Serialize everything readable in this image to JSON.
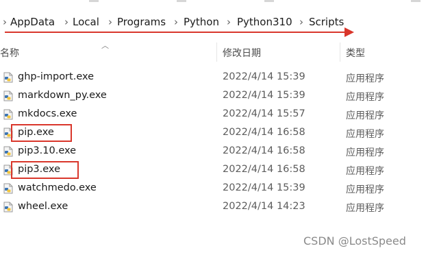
{
  "breadcrumb": {
    "items": [
      "AppData",
      "Local",
      "Programs",
      "Python",
      "Python310",
      "Scripts"
    ],
    "separator": "›"
  },
  "columns": {
    "name": "名称",
    "modified": "修改日期",
    "type": "类型"
  },
  "files": [
    {
      "name": "ghp-import.exe",
      "modified": "2022/4/14 15:39",
      "type": "应用程序"
    },
    {
      "name": "markdown_py.exe",
      "modified": "2022/4/14 15:39",
      "type": "应用程序"
    },
    {
      "name": "mkdocs.exe",
      "modified": "2022/4/14 15:57",
      "type": "应用程序"
    },
    {
      "name": "pip.exe",
      "modified": "2022/4/14 16:58",
      "type": "应用程序"
    },
    {
      "name": "pip3.10.exe",
      "modified": "2022/4/14 16:58",
      "type": "应用程序"
    },
    {
      "name": "pip3.exe",
      "modified": "2022/4/14 16:58",
      "type": "应用程序"
    },
    {
      "name": "watchmedo.exe",
      "modified": "2022/4/14 15:39",
      "type": "应用程序"
    },
    {
      "name": "wheel.exe",
      "modified": "2022/4/14 14:23",
      "type": "应用程序"
    }
  ],
  "icons": {
    "file": "python-exe-icon",
    "sort": "sort-ascending-icon"
  },
  "colors": {
    "annotation": "#d9362b"
  },
  "watermark": "CSDN @LostSpeed"
}
